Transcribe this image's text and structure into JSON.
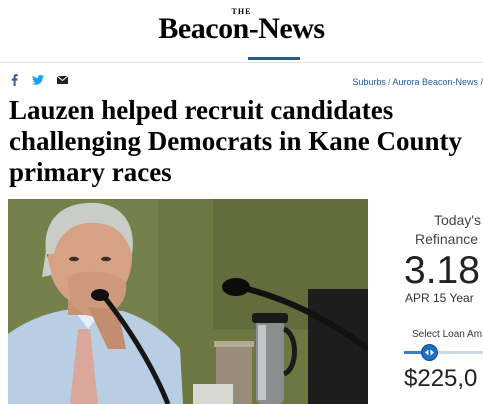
{
  "masthead": {
    "the_label": "THE",
    "brand": "Beacon-News",
    "accent_color": "#2a5c8a"
  },
  "social": {
    "icons": [
      "facebook-icon",
      "twitter-icon",
      "email-icon"
    ]
  },
  "breadcrumb": {
    "section": "Suburbs",
    "separator": "/",
    "subsection": "Aurora Beacon-News /"
  },
  "article": {
    "headline": "Lauzen helped recruit candidates challenging Democrats in Kane County primary races"
  },
  "ad": {
    "today_label": "Today's",
    "refinance_label": "Refinance",
    "rate": "3.18",
    "rate_date": "APR 15 Year",
    "select_label": "Select Loan Am",
    "slider_level": 0.35,
    "amount": "$225,0"
  }
}
